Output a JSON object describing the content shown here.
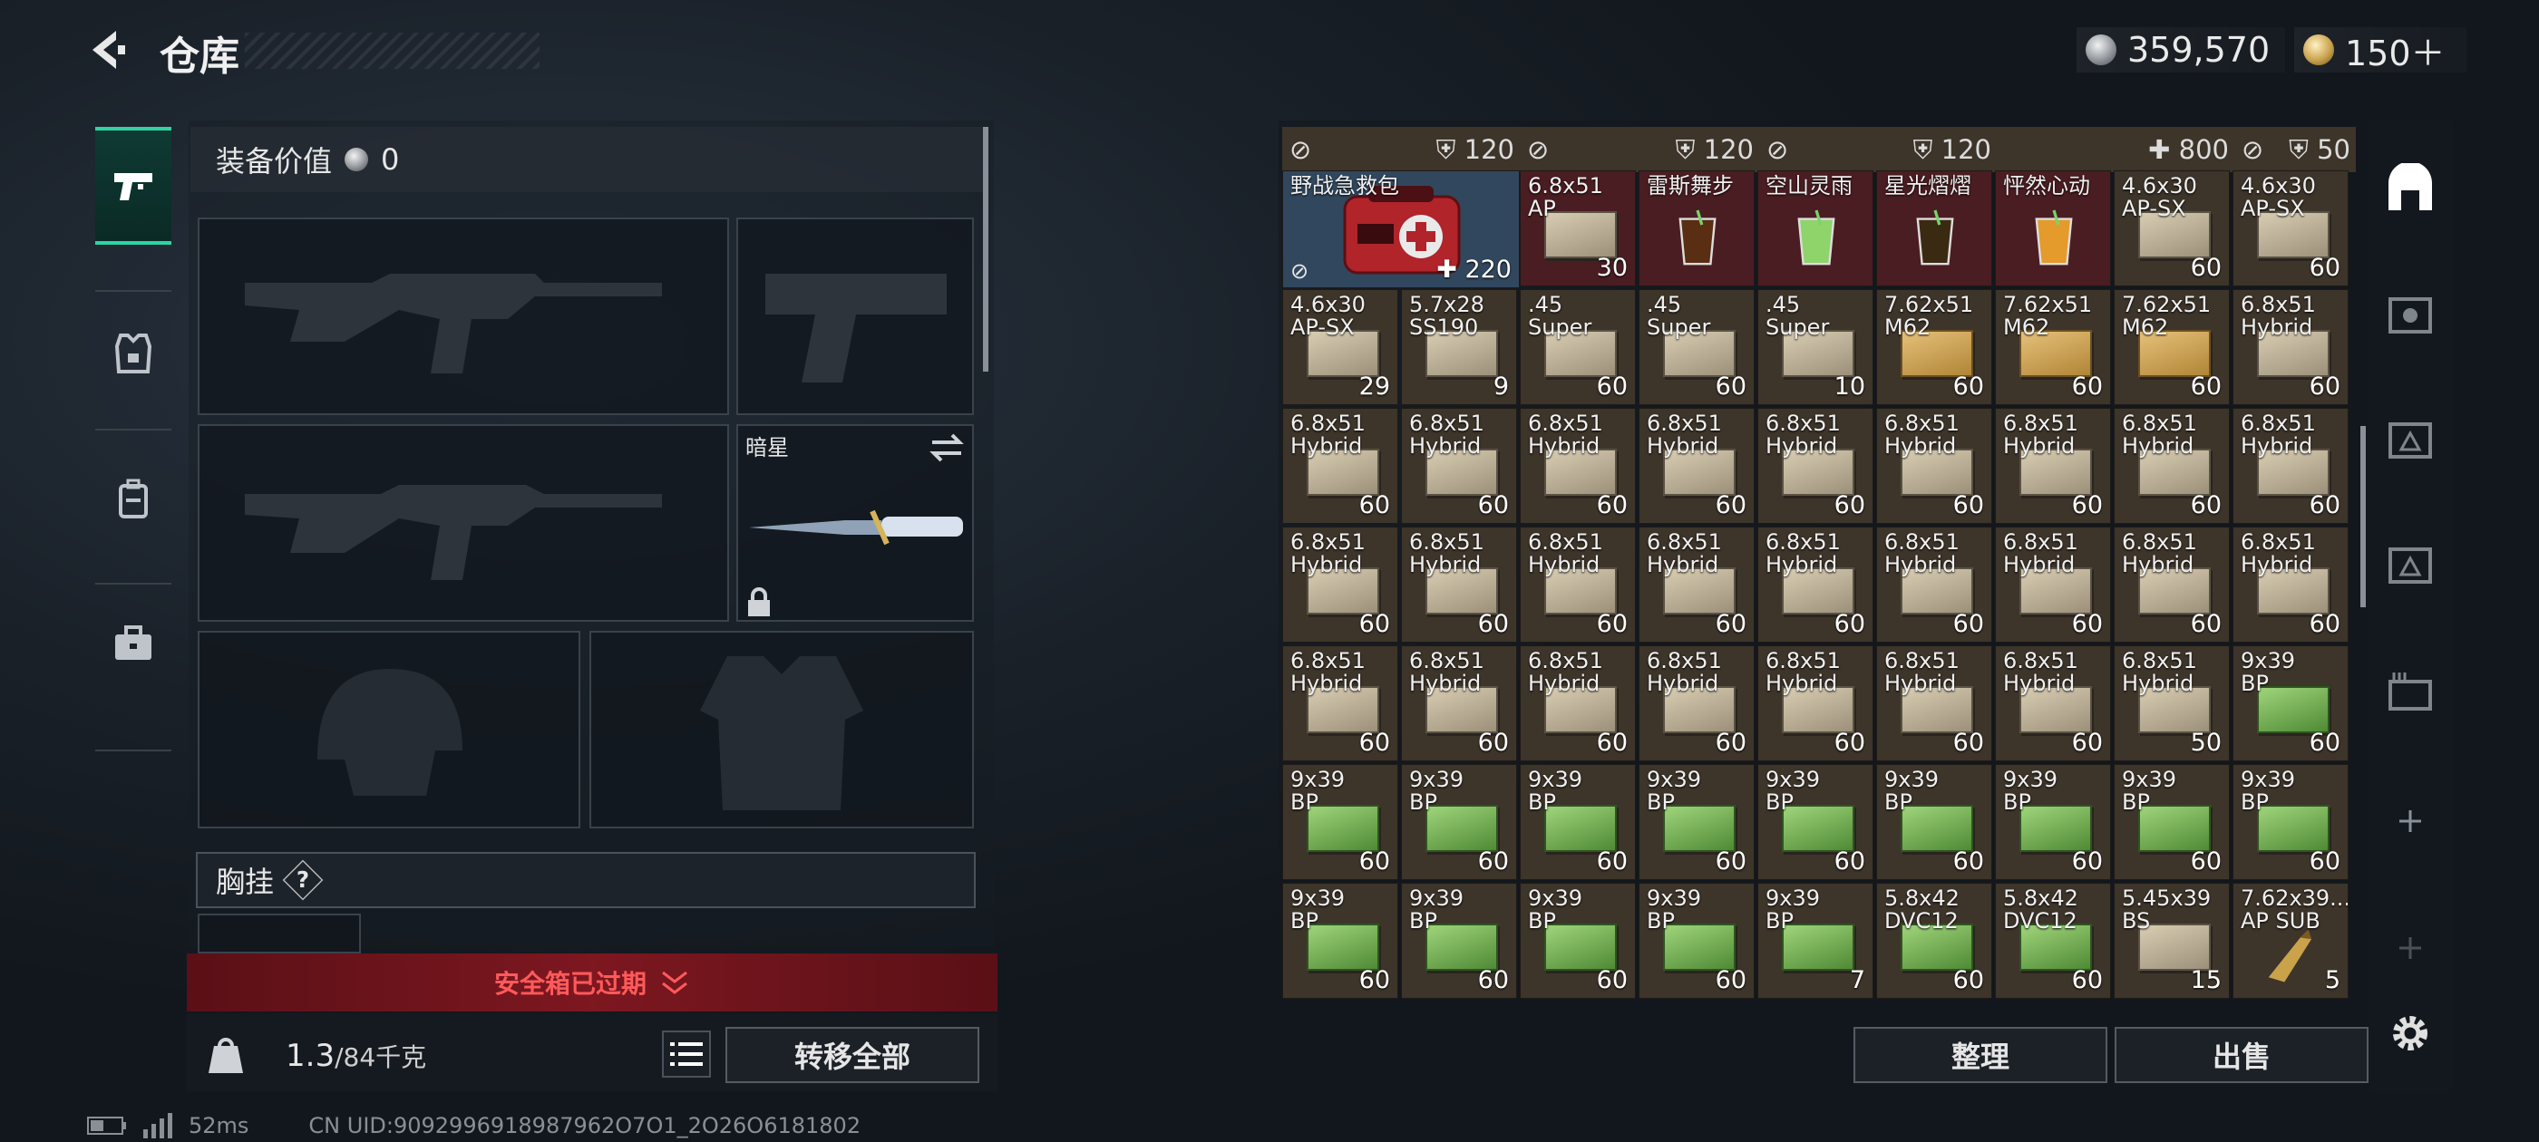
{
  "header": {
    "title": "仓库",
    "silver": "359,570",
    "gold": "150＋"
  },
  "equipment": {
    "value_label": "装备价值",
    "value": "0",
    "knife_name": "暗星",
    "chest_label": "胸挂",
    "chest_help": "?",
    "safe_box": "安全箱已过期",
    "weight": "1.3",
    "weight_cap": "/84千克",
    "transfer_all": "转移全部"
  },
  "storage": {
    "top_labels": [
      "120",
      "120",
      "120",
      "800",
      "50"
    ],
    "medkit": {
      "name": "野战急救包",
      "durability": "220"
    },
    "cells": [
      {
        "c": 2,
        "r": 0,
        "name": "6.8x51\nAP",
        "count": "30",
        "bg": "red",
        "box": "tan-drink"
      },
      {
        "c": 3,
        "r": 0,
        "name": "雷斯舞步",
        "count": "",
        "bg": "red",
        "box": "drink-dark"
      },
      {
        "c": 4,
        "r": 0,
        "name": "空山灵雨",
        "count": "",
        "bg": "red",
        "box": "drink-green"
      },
      {
        "c": 5,
        "r": 0,
        "name": "星光熠熠",
        "count": "",
        "bg": "red",
        "box": "drink-mint"
      },
      {
        "c": 6,
        "r": 0,
        "name": "怦然心动",
        "count": "",
        "bg": "red",
        "box": "drink-orange"
      },
      {
        "c": 7,
        "r": 0,
        "name": "4.6x30\nAP-SX",
        "count": "60",
        "box": "plain"
      },
      {
        "c": 8,
        "r": 0,
        "name": "4.6x30\nAP-SX",
        "count": "60",
        "box": "plain"
      },
      {
        "c": 0,
        "r": 1,
        "name": "4.6x30\nAP-SX",
        "count": "29",
        "box": "plain"
      },
      {
        "c": 1,
        "r": 1,
        "name": "5.7x28\nSS190",
        "count": "9",
        "box": "plain"
      },
      {
        "c": 2,
        "r": 1,
        "name": ".45\nSuper",
        "count": "60",
        "box": "plain"
      },
      {
        "c": 3,
        "r": 1,
        "name": ".45\nSuper",
        "count": "60",
        "box": "plain"
      },
      {
        "c": 4,
        "r": 1,
        "name": ".45\nSuper",
        "count": "10",
        "box": "plain"
      },
      {
        "c": 5,
        "r": 1,
        "name": "7.62x51\nM62",
        "count": "60",
        "box": "tan"
      },
      {
        "c": 6,
        "r": 1,
        "name": "7.62x51\nM62",
        "count": "60",
        "box": "tan"
      },
      {
        "c": 7,
        "r": 1,
        "name": "7.62x51\nM62",
        "count": "60",
        "box": "tan"
      },
      {
        "c": 8,
        "r": 1,
        "name": "6.8x51\nHybrid",
        "count": "60",
        "box": "plain"
      },
      {
        "c": 0,
        "r": 2,
        "name": "6.8x51\nHybrid",
        "count": "60",
        "box": "plain"
      },
      {
        "c": 1,
        "r": 2,
        "name": "6.8x51\nHybrid",
        "count": "60",
        "box": "plain"
      },
      {
        "c": 2,
        "r": 2,
        "name": "6.8x51\nHybrid",
        "count": "60",
        "box": "plain"
      },
      {
        "c": 3,
        "r": 2,
        "name": "6.8x51\nHybrid",
        "count": "60",
        "box": "plain"
      },
      {
        "c": 4,
        "r": 2,
        "name": "6.8x51\nHybrid",
        "count": "60",
        "box": "plain"
      },
      {
        "c": 5,
        "r": 2,
        "name": "6.8x51\nHybrid",
        "count": "60",
        "box": "plain"
      },
      {
        "c": 6,
        "r": 2,
        "name": "6.8x51\nHybrid",
        "count": "60",
        "box": "plain"
      },
      {
        "c": 7,
        "r": 2,
        "name": "6.8x51\nHybrid",
        "count": "60",
        "box": "plain"
      },
      {
        "c": 8,
        "r": 2,
        "name": "6.8x51\nHybrid",
        "count": "60",
        "box": "plain"
      },
      {
        "c": 0,
        "r": 3,
        "name": "6.8x51\nHybrid",
        "count": "60",
        "box": "plain"
      },
      {
        "c": 1,
        "r": 3,
        "name": "6.8x51\nHybrid",
        "count": "60",
        "box": "plain"
      },
      {
        "c": 2,
        "r": 3,
        "name": "6.8x51\nHybrid",
        "count": "60",
        "box": "plain"
      },
      {
        "c": 3,
        "r": 3,
        "name": "6.8x51\nHybrid",
        "count": "60",
        "box": "plain"
      },
      {
        "c": 4,
        "r": 3,
        "name": "6.8x51\nHybrid",
        "count": "60",
        "box": "plain"
      },
      {
        "c": 5,
        "r": 3,
        "name": "6.8x51\nHybrid",
        "count": "60",
        "box": "plain"
      },
      {
        "c": 6,
        "r": 3,
        "name": "6.8x51\nHybrid",
        "count": "60",
        "box": "plain"
      },
      {
        "c": 7,
        "r": 3,
        "name": "6.8x51\nHybrid",
        "count": "60",
        "box": "plain"
      },
      {
        "c": 8,
        "r": 3,
        "name": "6.8x51\nHybrid",
        "count": "60",
        "box": "plain"
      },
      {
        "c": 0,
        "r": 4,
        "name": "6.8x51\nHybrid",
        "count": "60",
        "box": "plain"
      },
      {
        "c": 1,
        "r": 4,
        "name": "6.8x51\nHybrid",
        "count": "60",
        "box": "plain"
      },
      {
        "c": 2,
        "r": 4,
        "name": "6.8x51\nHybrid",
        "count": "60",
        "box": "plain"
      },
      {
        "c": 3,
        "r": 4,
        "name": "6.8x51\nHybrid",
        "count": "60",
        "box": "plain"
      },
      {
        "c": 4,
        "r": 4,
        "name": "6.8x51\nHybrid",
        "count": "60",
        "box": "plain"
      },
      {
        "c": 5,
        "r": 4,
        "name": "6.8x51\nHybrid",
        "count": "60",
        "box": "plain"
      },
      {
        "c": 6,
        "r": 4,
        "name": "6.8x51\nHybrid",
        "count": "60",
        "box": "plain"
      },
      {
        "c": 7,
        "r": 4,
        "name": "6.8x51\nHybrid",
        "count": "50",
        "box": "plain"
      },
      {
        "c": 8,
        "r": 4,
        "name": "9x39\nBP",
        "count": "60",
        "box": "green"
      },
      {
        "c": 0,
        "r": 5,
        "name": "9x39\nBP",
        "count": "60",
        "box": "green"
      },
      {
        "c": 1,
        "r": 5,
        "name": "9x39\nBP",
        "count": "60",
        "box": "green"
      },
      {
        "c": 2,
        "r": 5,
        "name": "9x39\nBP",
        "count": "60",
        "box": "green"
      },
      {
        "c": 3,
        "r": 5,
        "name": "9x39\nBP",
        "count": "60",
        "box": "green"
      },
      {
        "c": 4,
        "r": 5,
        "name": "9x39\nBP",
        "count": "60",
        "box": "green"
      },
      {
        "c": 5,
        "r": 5,
        "name": "9x39\nBP",
        "count": "60",
        "box": "green"
      },
      {
        "c": 6,
        "r": 5,
        "name": "9x39\nBP",
        "count": "60",
        "box": "green"
      },
      {
        "c": 7,
        "r": 5,
        "name": "9x39\nBP",
        "count": "60",
        "box": "green"
      },
      {
        "c": 8,
        "r": 5,
        "name": "9x39\nBP",
        "count": "60",
        "box": "green"
      },
      {
        "c": 0,
        "r": 6,
        "name": "9x39\nBP",
        "count": "60",
        "box": "green"
      },
      {
        "c": 1,
        "r": 6,
        "name": "9x39\nBP",
        "count": "60",
        "box": "green"
      },
      {
        "c": 2,
        "r": 6,
        "name": "9x39\nBP",
        "count": "60",
        "box": "green"
      },
      {
        "c": 3,
        "r": 6,
        "name": "9x39\nBP",
        "count": "60",
        "box": "green"
      },
      {
        "c": 4,
        "r": 6,
        "name": "9x39\nBP",
        "count": "7",
        "box": "green"
      },
      {
        "c": 5,
        "r": 6,
        "name": "5.8x42\nDVC12",
        "count": "60",
        "box": "green"
      },
      {
        "c": 6,
        "r": 6,
        "name": "5.8x42\nDVC12",
        "count": "60",
        "box": "green"
      },
      {
        "c": 7,
        "r": 6,
        "name": "5.45x39\nBS",
        "count": "15",
        "box": "plain"
      },
      {
        "c": 8,
        "r": 6,
        "name": "7.62x39...\nAP SUB",
        "count": "5",
        "box": "bullet"
      }
    ],
    "sort": "整理",
    "sell": "出售"
  },
  "status": {
    "ping": "52ms",
    "uid": "CN UID:9092996918987962O7O1_2O26O6181802"
  },
  "colors": {
    "accent": "#2fd3a5",
    "warning": "#ff5a5a",
    "slot_red": "#4a1d22",
    "slot_blue": "#31475e"
  }
}
